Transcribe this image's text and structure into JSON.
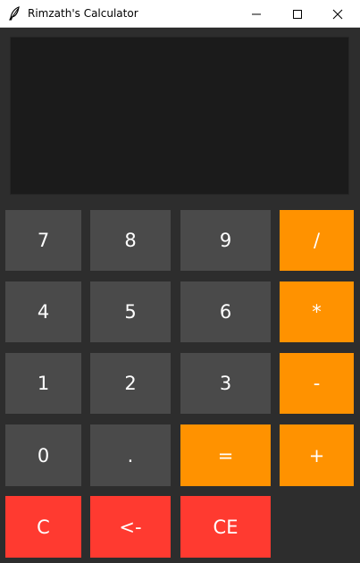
{
  "window": {
    "title": "Rimzath's Calculator",
    "icon": "feather-icon",
    "controls": [
      "minimize-icon",
      "maximize-icon",
      "close-icon"
    ]
  },
  "display": {
    "value": ""
  },
  "keys": {
    "seven": "7",
    "eight": "8",
    "nine": "9",
    "divide": "/",
    "four": "4",
    "five": "5",
    "six": "6",
    "multiply": "*",
    "one": "1",
    "two": "2",
    "three": "3",
    "subtract": "-",
    "zero": "0",
    "dot": ".",
    "equals": "=",
    "add": "+",
    "clear": "C",
    "backspace": "<-",
    "clear_entry": "CE"
  },
  "colors": {
    "number_key": "#4a4a4a",
    "operator_key": "#ff9200",
    "clear_key": "#ff3a30",
    "background": "#2d2d2d",
    "display": "#1b1b1b"
  }
}
